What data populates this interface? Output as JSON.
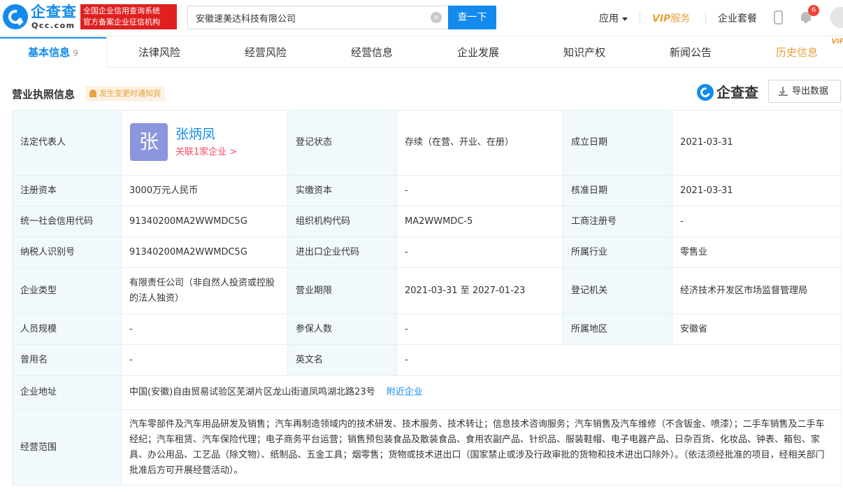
{
  "header": {
    "logo_cn": "企查查",
    "logo_en": "Qcc.com",
    "badge_line1": "全国企业信用查询系统",
    "badge_line2": "官方备案企业征信机构",
    "search_value": "安徽速美达科技有限公司",
    "search_clear": "×",
    "search_button": "查一下",
    "nav_app": "应用",
    "nav_vip_prefix": "VIP",
    "nav_vip_suffix": "服务",
    "nav_plan": "企业套餐",
    "notification_count": "6"
  },
  "tabs": [
    {
      "label": "基本信息",
      "count": "9"
    },
    {
      "label": "法律风险"
    },
    {
      "label": "经营风险"
    },
    {
      "label": "经营信息"
    },
    {
      "label": "企业发展"
    },
    {
      "label": "知识产权"
    },
    {
      "label": "新闻公告"
    },
    {
      "label": "历史信息",
      "badge": "VIP"
    }
  ],
  "section": {
    "title": "营业执照信息",
    "notify": "发生变更时通知我",
    "brand": "企查查",
    "export": "导出数据"
  },
  "legal_rep": {
    "label": "法定代表人",
    "avatar_char": "张",
    "name": "张炳凤",
    "related": "关联1家企业 >"
  },
  "rows": {
    "reg_status_label": "登记状态",
    "reg_status": "存续（在营、开业、在册）",
    "found_date_label": "成立日期",
    "found_date": "2021-03-31",
    "reg_capital_label": "注册资本",
    "reg_capital": "3000万元人民币",
    "paid_capital_label": "实缴资本",
    "paid_capital": "-",
    "approve_date_label": "核准日期",
    "approve_date": "2021-03-31",
    "credit_code_label": "统一社会信用代码",
    "credit_code": "91340200MA2WWMDC5G",
    "org_code_label": "组织机构代码",
    "org_code": "MA2WWMDC-5",
    "biz_reg_label": "工商注册号",
    "biz_reg": "-",
    "taxpayer_label": "纳税人识别号",
    "taxpayer": "91340200MA2WWMDC5G",
    "import_export_label": "进出口企业代码",
    "import_export": "-",
    "industry_label": "所属行业",
    "industry": "零售业",
    "company_type_label": "企业类型",
    "company_type": "有限责任公司（非自然人投资或控股的法人独资）",
    "term_label": "营业期限",
    "term": "2021-03-31 至 2027-01-23",
    "reg_authority_label": "登记机关",
    "reg_authority": "经济技术开发区市场监督管理局",
    "staff_label": "人员规模",
    "staff": "-",
    "insured_label": "参保人数",
    "insured": "-",
    "region_label": "所属地区",
    "region": "安徽省",
    "former_name_label": "曾用名",
    "former_name": "-",
    "english_name_label": "英文名",
    "english_name": "-",
    "address_label": "企业地址",
    "address": "中国(安徽)自由贸易试验区芜湖片区龙山街道凤鸣湖北路23号",
    "nearby": "附近企业",
    "scope_label": "经营范围",
    "scope": "汽车零部件及汽车用品研发及销售；汽车再制造领域内的技术研发、技术服务、技术转让；信息技术咨询服务；汽车销售及汽车维修（不含钣金、喷漆）；二手车销售及二手车经纪；汽车租赁、汽车保险代理；电子商务平台运营；销售预包装食品及散装食品、食用农副产品、针织品、服装鞋帽、电子电器产品、日杂百货、化妆品、钟表、箱包、家具、办公用品、工艺品（除文物）、纸制品、五金工具；烟零售；货物或技术进出口（国家禁止或涉及行政审批的货物和技术进出口除外）。（依法须经批准的项目，经相关部门批准后方可开展经营活动）。"
  },
  "colors": {
    "brand_blue": "#128bed",
    "label_bg": "#f2f9fc",
    "vip_gold": "#e6a23c",
    "link_red": "#fd485e"
  }
}
